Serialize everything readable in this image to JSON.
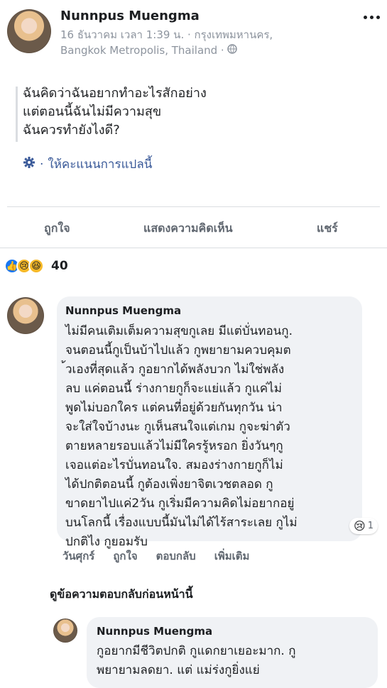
{
  "post": {
    "author": "Nunnpus Muengma",
    "timestamp_line1": "16 ธันวาคม เวลา 1:39 น. · กรุงเทพมหานคร,",
    "timestamp_line2": "Bangkok Metropolis, Thailand ·",
    "more_icon": "more-horizontal-icon",
    "text_line1": "ฉันคิดว่าฉันอยากทำอะไรสักอย่าง",
    "text_line2": "แต่ตอนนี้ฉันไม่มีความสุข",
    "text_line3": "ฉันควรทำยังไงดี?",
    "translate_label": "ให้คะแนนการแปลนี้"
  },
  "actions": {
    "like": "ถูกใจ",
    "comment": "แสดงความคิดเห็น",
    "share": "แชร์"
  },
  "reactions": {
    "count": "40",
    "types": [
      "like",
      "sad",
      "haha"
    ],
    "colors": {
      "like": "#1877f2",
      "sad": "#f7b928",
      "haha": "#f7b928"
    }
  },
  "comment1": {
    "author": "Nunnpus Muengma",
    "text": "ไม่มีคนเติมเต็มความสุขกูเลย มีแต่บั่นทอนกู.\nจนตอนนี้กูเป็นบ้าไปแล้ว กูพยายามควบคุมต\n้วเองที่สุดแล้ว กูอยากได้พลังบวก ไม่ใช่พลัง\nลบ แค่ตอนนี้ ร่างกายกูก็จะแย่แล้ว กูแค่ไม่\nพูดไม่บอกใคร แต่คนที่อยู่ด้วยกันทุกวัน น่า\nจะใส่ใจบ้างนะ กูเห็นสนใจแต่เกม กูจะฆ่าตัว\nตายหลายรอบแล้วไม่มีใครรู้หรอก ยิ่งวันๆกู\nเจอแต่อะไรบั่นทอนใจ. สมองร่างกายกูก็ไม่\nได้ปกติตอนนี้ กูต้องเพิ่งยาจิตเวชตลอด กู\nขาดยาไปแค่2วัน กูเริ่มมีความคิดไม่อยากอยู่\nบนโลกนี้ เรื่องแบบนี้มันไม่ได้ไร้สาระเลย กูไม่\nปกติไง กูยอมรับ",
    "reaction_count": "1",
    "day": "วันศุกร์",
    "like": "ถูกใจ",
    "reply": "ตอบกลับ",
    "more": "เพิ่มเติม"
  },
  "previous_replies_label": "ดูข้อความตอบกลับก่อนหน้านี้",
  "comment2": {
    "author": "Nunnpus Muengma",
    "text": "กูอยากมีชีวิตปกติ กูแดกยาเยอะมาก. กู\nพยายามลดยา. แต่ แม่ร่งกูยิ่งแย่"
  }
}
